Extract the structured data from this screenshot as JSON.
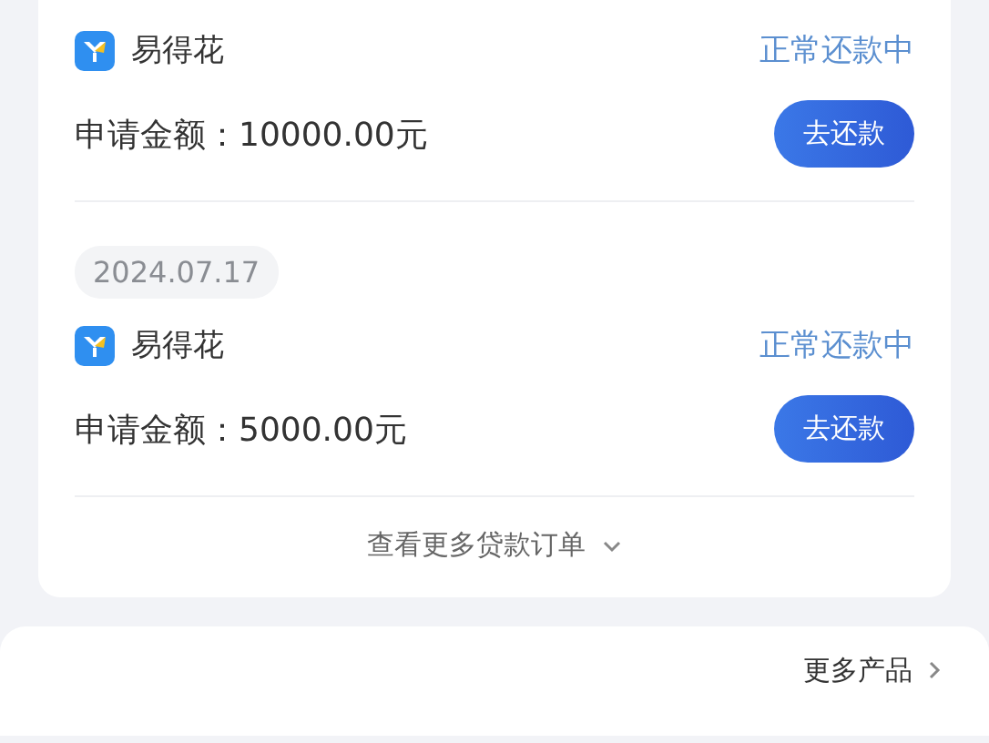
{
  "loans": [
    {
      "product": "易得花",
      "status": "正常还款中",
      "amount": "申请金额：10000.00元",
      "button": "去还款"
    },
    {
      "date": "2024.07.17",
      "product": "易得花",
      "status": "正常还款中",
      "amount": "申请金额：5000.00元",
      "button": "去还款"
    }
  ],
  "more_orders": {
    "label": "查看更多贷款订单",
    "expanded": false
  },
  "more_products": {
    "label": "更多产品"
  }
}
